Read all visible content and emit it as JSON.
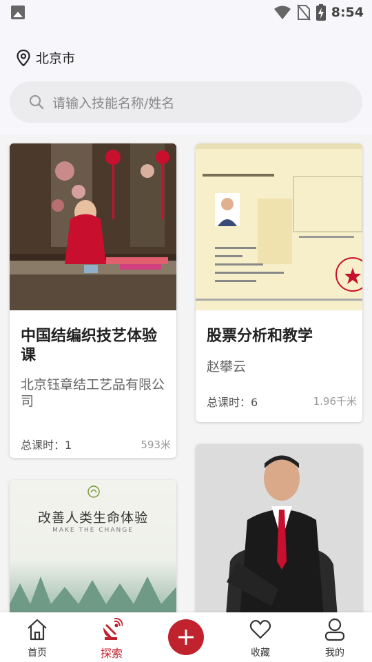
{
  "status_bar": {
    "time": "8:54",
    "icons": [
      "gallery-icon",
      "wifi-icon",
      "no-sim-icon",
      "battery-charging-icon"
    ]
  },
  "header": {
    "location": "北京市",
    "search_placeholder": "请输入技能名称/姓名"
  },
  "cards": [
    {
      "title": "中国结编织技艺体验课",
      "subtitle": "北京钰章结工艺品有限公司",
      "lessons": "总课时：1",
      "distance": "593米",
      "image": "chinese-knot-weaving-photo"
    },
    {
      "title": "股票分析和教学",
      "subtitle": "赵攀云",
      "lessons": "总课时：6",
      "distance": "1.96千米",
      "image": "fund-certificate-photo"
    },
    {
      "image": "product-poster-photo",
      "poster_title": "改善人类生命体验",
      "poster_subtitle": "MAKE THE CHANGE"
    },
    {
      "image": "portrait-man-in-suit-photo"
    }
  ],
  "tabbar": {
    "home": "首页",
    "explore": "探索",
    "favorites": "收藏",
    "mine": "我的",
    "accent_color": "#c1232e"
  }
}
